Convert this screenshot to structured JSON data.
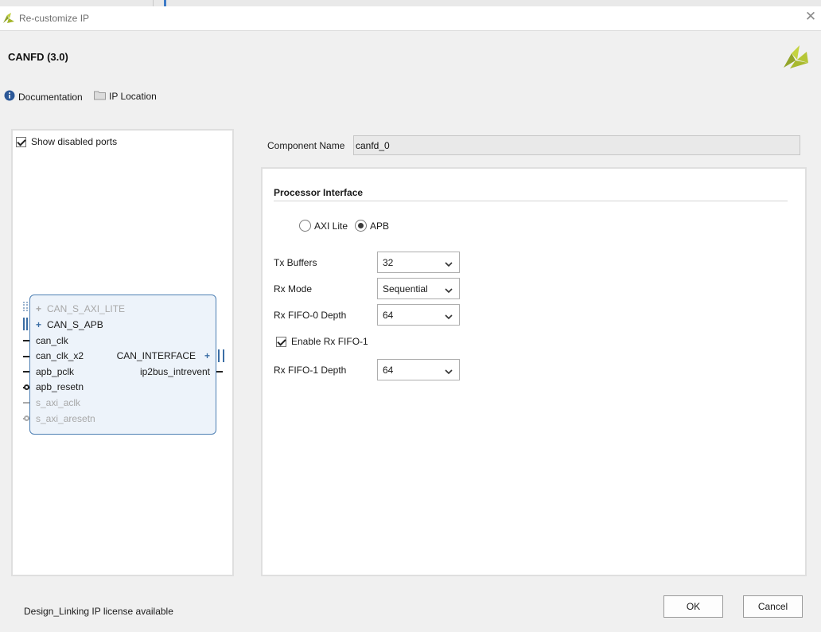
{
  "window": {
    "title": "Re-customize IP",
    "close_symbol": "✕"
  },
  "header": {
    "ip_title": "CANFD (3.0)",
    "logo_icon": "vivado-logo-icon",
    "links": {
      "documentation": "Documentation",
      "ip_location": "IP Location"
    }
  },
  "symbol_panel": {
    "show_disabled_ports_label": "Show disabled ports",
    "show_disabled_ports_checked": true,
    "block": {
      "inputs": [
        {
          "name": "CAN_S_AXI_LITE",
          "bus": true,
          "disabled": true
        },
        {
          "name": "CAN_S_APB",
          "bus": true,
          "disabled": false
        },
        {
          "name": "can_clk",
          "bus": false,
          "disabled": false
        },
        {
          "name": "can_clk_x2",
          "bus": false,
          "disabled": false
        },
        {
          "name": "apb_pclk",
          "bus": false,
          "disabled": false
        },
        {
          "name": "apb_resetn",
          "bus": false,
          "disabled": false
        },
        {
          "name": "s_axi_aclk",
          "bus": false,
          "disabled": true
        },
        {
          "name": "s_axi_aresetn",
          "bus": false,
          "disabled": true
        }
      ],
      "outputs": [
        {
          "name": "CAN_INTERFACE",
          "bus": true
        },
        {
          "name": "ip2bus_intrevent",
          "bus": false
        }
      ]
    }
  },
  "config": {
    "component_name_label": "Component Name",
    "component_name_value": "canfd_0",
    "section_title": "Processor Interface",
    "interface_options": [
      {
        "label": "AXI Lite",
        "selected": false
      },
      {
        "label": "APB",
        "selected": true
      }
    ],
    "tx_buffers": {
      "label": "Tx Buffers",
      "value": "32"
    },
    "rx_mode": {
      "label": "Rx Mode",
      "value": "Sequential"
    },
    "rx_fifo0_depth": {
      "label": "Rx FIFO-0 Depth",
      "value": "64"
    },
    "enable_rx_fifo1": {
      "label": "Enable Rx FIFO-1",
      "checked": true
    },
    "rx_fifo1_depth": {
      "label": "Rx FIFO-1 Depth",
      "value": "64"
    }
  },
  "footer": {
    "license_text": "Design_Linking IP license available",
    "ok_label": "OK",
    "cancel_label": "Cancel"
  },
  "colors": {
    "block_fill": "#edf3fa",
    "block_border": "#4d7fb3",
    "bus_blue": "#3b6ea5",
    "logo_green": "#a4b52a"
  }
}
